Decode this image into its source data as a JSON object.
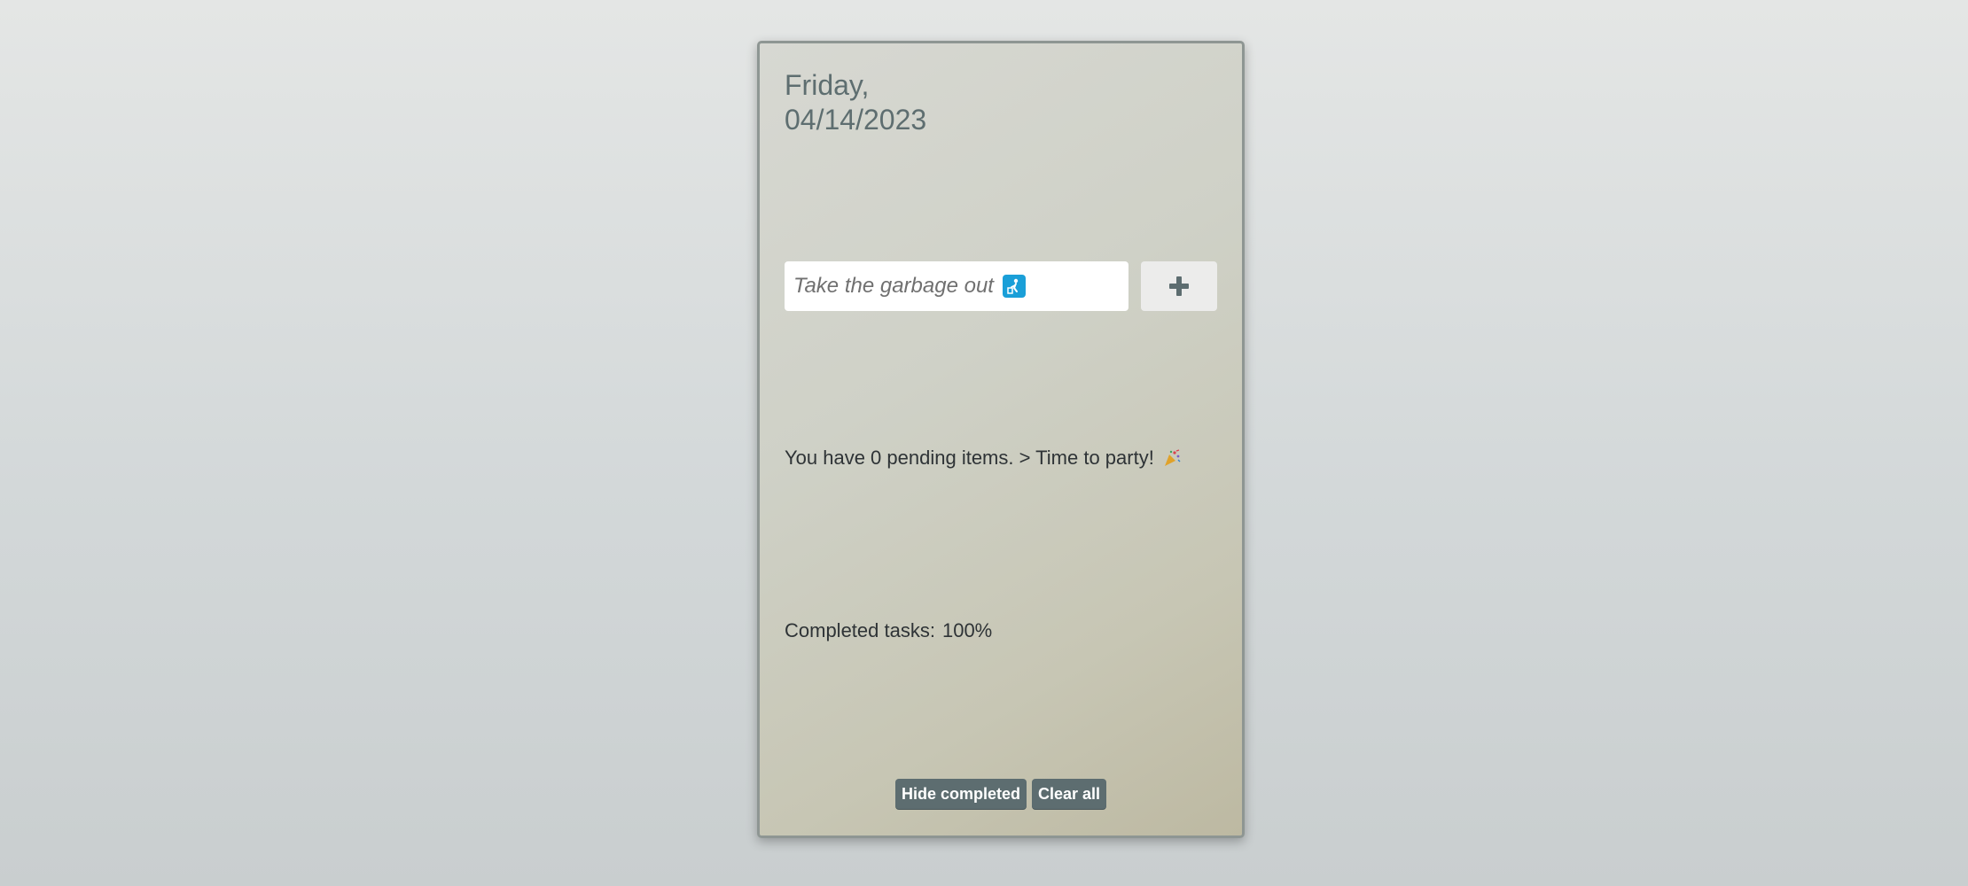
{
  "header": {
    "day": "Friday,",
    "date": "04/14/2023"
  },
  "input": {
    "placeholder": "Take the garbage out",
    "value": "",
    "icon": "person-disposing-trash-icon",
    "icon_color": "#1a9fd8"
  },
  "add_button": {
    "icon": "plus-icon",
    "icon_color": "#5d6d70"
  },
  "status": {
    "message": "You have 0 pending items. > Time to party!",
    "icon": "party-popper-icon"
  },
  "completed": {
    "label": "Completed tasks:",
    "value": "100%"
  },
  "footer": {
    "hide_completed_label": "Hide completed",
    "clear_all_label": "Clear all"
  },
  "colors": {
    "accent": "#5d6d70",
    "date_text": "#5e6e70",
    "card_border": "#8e9693"
  }
}
